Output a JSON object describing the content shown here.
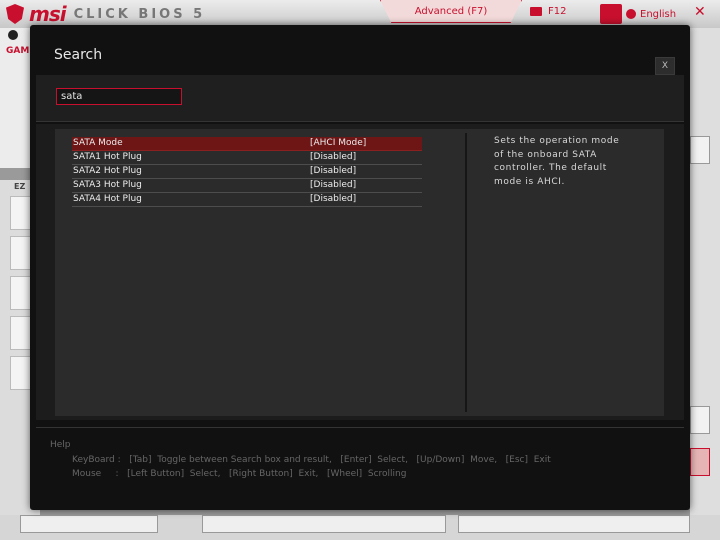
{
  "app": {
    "brand": "msi",
    "product": "CLICK BIOS 5",
    "advanced_tab": "Advanced (F7)",
    "screenshot_key": "F12",
    "language": "English",
    "close_symbol": "✕",
    "game_label": "GAM",
    "ez_label": "EZ"
  },
  "colors": {
    "accent": "#c8102e",
    "modal_bg": "#111111",
    "selected_row": "#6e1515"
  },
  "search": {
    "title": "Search",
    "close_label": "X",
    "query": "sata"
  },
  "results": [
    {
      "name": "SATA Mode",
      "value": "[AHCI Mode]",
      "selected": true
    },
    {
      "name": "SATA1 Hot Plug",
      "value": "[Disabled]",
      "selected": false
    },
    {
      "name": "SATA2 Hot Plug",
      "value": "[Disabled]",
      "selected": false
    },
    {
      "name": "SATA3 Hot Plug",
      "value": "[Disabled]",
      "selected": false
    },
    {
      "name": "SATA4 Hot Plug",
      "value": "[Disabled]",
      "selected": false
    }
  ],
  "description": "Sets the operation mode of the onboard SATA controller. The default mode is AHCI.",
  "help": {
    "title": "Help",
    "keyboard": "KeyBoard :   [Tab]  Toggle between Search box and result,   [Enter]  Select,   [Up/Down]  Move,   [Esc]  Exit",
    "mouse": "Mouse     :   [Left Button]  Select,   [Right Button]  Exit,   [Wheel]  Scrolling"
  }
}
